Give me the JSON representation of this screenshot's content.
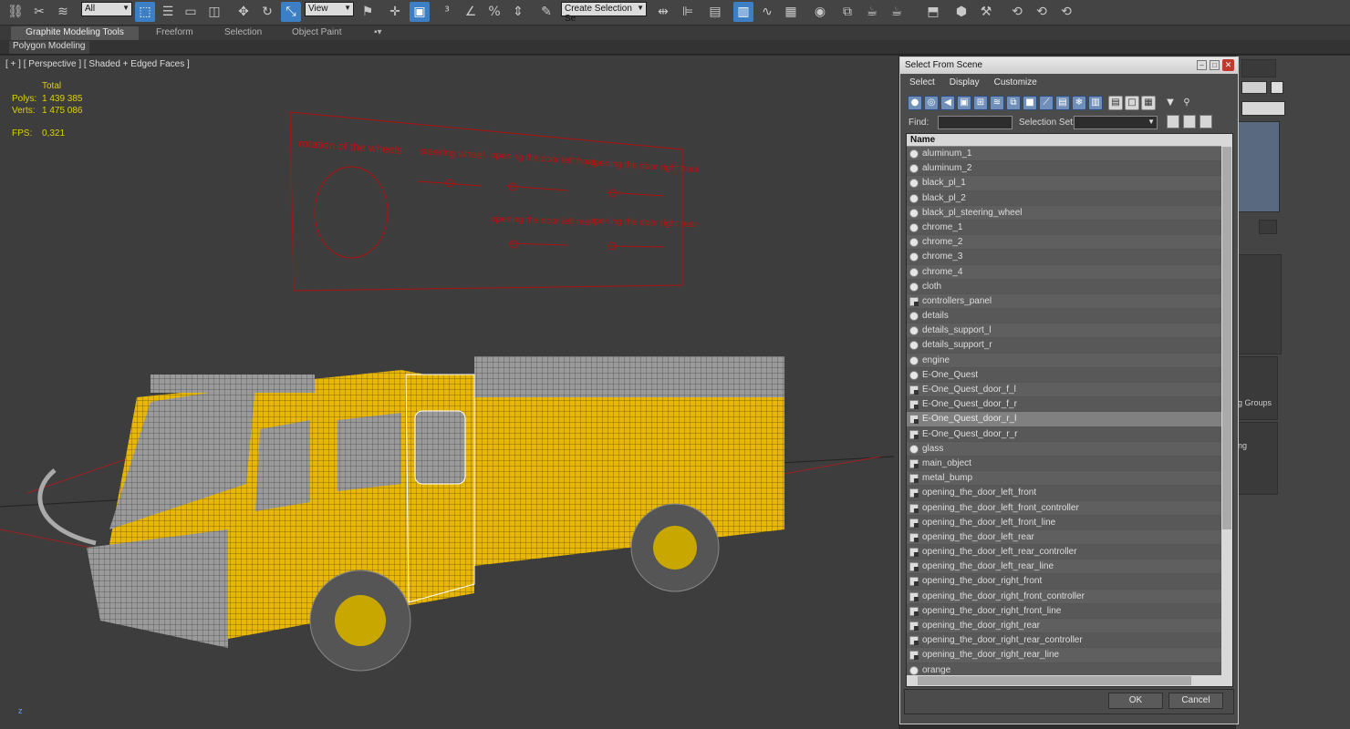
{
  "toolbar": {
    "filter_select": "All",
    "view_select": "View",
    "selection_set_select": "Create Selection Se",
    "icons": [
      "link-icon",
      "unlink-icon",
      "bind-icon",
      "select-icon",
      "select-by-name-icon",
      "rect-select-icon",
      "window-crossing-icon",
      "move-icon",
      "rotate-icon",
      "scale-icon",
      "pivot-icon",
      "snap-icon",
      "angle-snap-icon",
      "percent-snap-icon",
      "spinner-snap-icon",
      "edit-named-sel-icon",
      "mirror-icon",
      "align-icon",
      "layer-icon",
      "scene-explorer-icon",
      "curve-editor-icon",
      "schematic-icon",
      "material-editor-icon",
      "render-setup-icon",
      "render-frame-icon",
      "render-icon",
      "project-icon",
      "asset-icon",
      "hierarchy-icon",
      "motion-icon",
      "display-icon"
    ]
  },
  "ribbon": {
    "tabs": [
      "Graphite Modeling Tools",
      "Freeform",
      "Selection",
      "Object Paint"
    ],
    "sub_button": "Polygon Modeling"
  },
  "viewport": {
    "label": "[ + ] [ Perspective ] [ Shaded + Edged Faces ]",
    "stats_header": "Total",
    "polys_label": "Polys:",
    "polys_value": "1 439 385",
    "verts_label": "Verts:",
    "verts_value": "1 475 086",
    "fps_label": "FPS:",
    "fps_value": "0,321",
    "panel_labels": {
      "wheels": "rotation of the wheels",
      "steering": "steering wheel",
      "door_lf": "opening the door left front",
      "door_rf": "opening the door right front",
      "door_lr": "opening the door left rear",
      "door_rr": "opening the door right rear"
    }
  },
  "cmdpanel": {
    "label_groups": "g Groups",
    "label_ng": "ng"
  },
  "dialog": {
    "title": "Select From Scene",
    "menu": [
      "Select",
      "Display",
      "Customize"
    ],
    "find_label": "Find:",
    "find_value": "",
    "selection_set_label": "Selection Set:",
    "column_name": "Name",
    "items": [
      {
        "name": "aluminum_1",
        "type": "mesh"
      },
      {
        "name": "aluminum_2",
        "type": "mesh"
      },
      {
        "name": "black_pl_1",
        "type": "mesh"
      },
      {
        "name": "black_pl_2",
        "type": "mesh"
      },
      {
        "name": "black_pl_steering_wheel",
        "type": "mesh"
      },
      {
        "name": "chrome_1",
        "type": "mesh"
      },
      {
        "name": "chrome_2",
        "type": "mesh"
      },
      {
        "name": "chrome_3",
        "type": "mesh"
      },
      {
        "name": "chrome_4",
        "type": "mesh"
      },
      {
        "name": "cloth",
        "type": "mesh"
      },
      {
        "name": "controllers_panel",
        "type": "group"
      },
      {
        "name": "details",
        "type": "mesh"
      },
      {
        "name": "details_support_l",
        "type": "mesh"
      },
      {
        "name": "details_support_r",
        "type": "mesh"
      },
      {
        "name": "engine",
        "type": "mesh"
      },
      {
        "name": "E-One_Quest",
        "type": "mesh"
      },
      {
        "name": "E-One_Quest_door_f_l",
        "type": "group"
      },
      {
        "name": "E-One_Quest_door_f_r",
        "type": "group"
      },
      {
        "name": "E-One_Quest_door_r_l",
        "type": "group",
        "selected": true
      },
      {
        "name": "E-One_Quest_door_r_r",
        "type": "group"
      },
      {
        "name": "glass",
        "type": "mesh"
      },
      {
        "name": "main_object",
        "type": "group"
      },
      {
        "name": "metal_bump",
        "type": "group"
      },
      {
        "name": "opening_the_door_left_front",
        "type": "group"
      },
      {
        "name": "opening_the_door_left_front_controller",
        "type": "group"
      },
      {
        "name": "opening_the_door_left_front_line",
        "type": "group"
      },
      {
        "name": "opening_the_door_left_rear",
        "type": "group"
      },
      {
        "name": "opening_the_door_left_rear_controller",
        "type": "group"
      },
      {
        "name": "opening_the_door_left_rear_line",
        "type": "group"
      },
      {
        "name": "opening_the_door_right_front",
        "type": "group"
      },
      {
        "name": "opening_the_door_right_front_controller",
        "type": "group"
      },
      {
        "name": "opening_the_door_right_front_line",
        "type": "group"
      },
      {
        "name": "opening_the_door_right_rear",
        "type": "group"
      },
      {
        "name": "opening_the_door_right_rear_controller",
        "type": "group"
      },
      {
        "name": "opening_the_door_right_rear_line",
        "type": "group"
      },
      {
        "name": "orange",
        "type": "mesh"
      }
    ],
    "ok_label": "OK",
    "cancel_label": "Cancel"
  },
  "colors": {
    "accent": "#3d7fc4",
    "stats": "#ddd100",
    "truck_yellow": "#e8b800",
    "controller_red": "#b01010"
  }
}
